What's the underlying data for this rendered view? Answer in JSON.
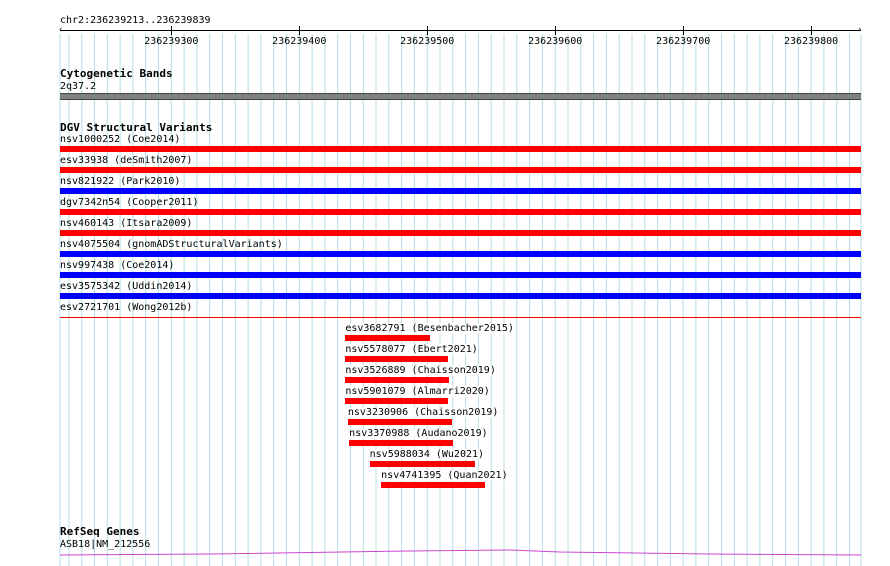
{
  "ruler": {
    "location": "chr2:236239213..236239839",
    "ticks": [
      "236239300",
      "236239400",
      "236239500",
      "236239600",
      "236239700",
      "236239800"
    ]
  },
  "cytoband": {
    "title": "Cytogenetic Bands",
    "label": "2q37.2",
    "color": "#808080"
  },
  "dgv": {
    "title": "DGV Structural Variants",
    "colors": {
      "red": "#ff0000",
      "blue": "#0000ff"
    },
    "full_rows": [
      {
        "label": "nsv1000252 (Coe2014)",
        "color": "red"
      },
      {
        "label": "esv33938 (deSmith2007)",
        "color": "red"
      },
      {
        "label": "nsv821922 (Park2010)",
        "color": "blue"
      },
      {
        "label": "dgv7342n54 (Cooper2011)",
        "color": "red"
      },
      {
        "label": "nsv460143 (Itsara2009)",
        "color": "red"
      },
      {
        "label": "nsv4075504 (gnomADStructuralVariants)",
        "color": "blue"
      },
      {
        "label": "nsv997438 (Coe2014)",
        "color": "blue"
      },
      {
        "label": "esv3575342 (Uddin2014)",
        "color": "blue"
      },
      {
        "label": "esv2721701 (Wong2012b)",
        "color": "red"
      }
    ],
    "short_rows": [
      {
        "label": "esv3682791 (Besenbacher2015)",
        "start": 236239436,
        "end": 236239502
      },
      {
        "label": "nsv5578077 (Ebert2021)",
        "start": 236239436,
        "end": 236239516
      },
      {
        "label": "nsv3526889 (Chaisson2019)",
        "start": 236239436,
        "end": 236239517
      },
      {
        "label": "nsv5901079 (Almarri2020)",
        "start": 236239436,
        "end": 236239516
      },
      {
        "label": "nsv3230906 (Chaisson2019)",
        "start": 236239438,
        "end": 236239519
      },
      {
        "label": "nsv3370988 (Audano2019)",
        "start": 236239439,
        "end": 236239520
      },
      {
        "label": "nsv5988034 (Wu2021)",
        "start": 236239455,
        "end": 236239537
      },
      {
        "label": "nsv4741395 (Quan2021)",
        "start": 236239464,
        "end": 236239545
      }
    ]
  },
  "refseq": {
    "title": "RefSeq Genes",
    "label": "ASB18|NM_212556",
    "color": "#cc44cc"
  }
}
